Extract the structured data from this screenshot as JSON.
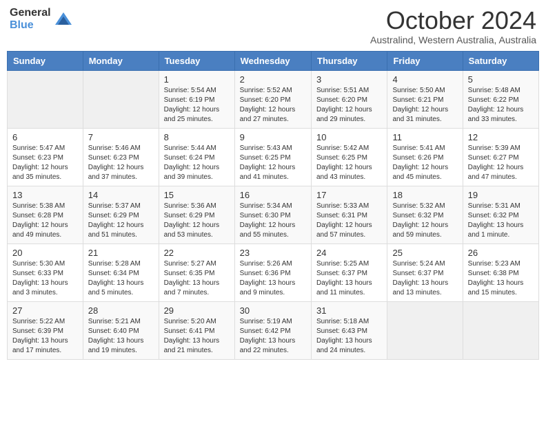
{
  "logo": {
    "general": "General",
    "blue": "Blue"
  },
  "title": "October 2024",
  "subtitle": "Australind, Western Australia, Australia",
  "headers": [
    "Sunday",
    "Monday",
    "Tuesday",
    "Wednesday",
    "Thursday",
    "Friday",
    "Saturday"
  ],
  "weeks": [
    [
      {
        "day": "",
        "info": ""
      },
      {
        "day": "",
        "info": ""
      },
      {
        "day": "1",
        "info": "Sunrise: 5:54 AM\nSunset: 6:19 PM\nDaylight: 12 hours and 25 minutes."
      },
      {
        "day": "2",
        "info": "Sunrise: 5:52 AM\nSunset: 6:20 PM\nDaylight: 12 hours and 27 minutes."
      },
      {
        "day": "3",
        "info": "Sunrise: 5:51 AM\nSunset: 6:20 PM\nDaylight: 12 hours and 29 minutes."
      },
      {
        "day": "4",
        "info": "Sunrise: 5:50 AM\nSunset: 6:21 PM\nDaylight: 12 hours and 31 minutes."
      },
      {
        "day": "5",
        "info": "Sunrise: 5:48 AM\nSunset: 6:22 PM\nDaylight: 12 hours and 33 minutes."
      }
    ],
    [
      {
        "day": "6",
        "info": "Sunrise: 5:47 AM\nSunset: 6:23 PM\nDaylight: 12 hours and 35 minutes."
      },
      {
        "day": "7",
        "info": "Sunrise: 5:46 AM\nSunset: 6:23 PM\nDaylight: 12 hours and 37 minutes."
      },
      {
        "day": "8",
        "info": "Sunrise: 5:44 AM\nSunset: 6:24 PM\nDaylight: 12 hours and 39 minutes."
      },
      {
        "day": "9",
        "info": "Sunrise: 5:43 AM\nSunset: 6:25 PM\nDaylight: 12 hours and 41 minutes."
      },
      {
        "day": "10",
        "info": "Sunrise: 5:42 AM\nSunset: 6:25 PM\nDaylight: 12 hours and 43 minutes."
      },
      {
        "day": "11",
        "info": "Sunrise: 5:41 AM\nSunset: 6:26 PM\nDaylight: 12 hours and 45 minutes."
      },
      {
        "day": "12",
        "info": "Sunrise: 5:39 AM\nSunset: 6:27 PM\nDaylight: 12 hours and 47 minutes."
      }
    ],
    [
      {
        "day": "13",
        "info": "Sunrise: 5:38 AM\nSunset: 6:28 PM\nDaylight: 12 hours and 49 minutes."
      },
      {
        "day": "14",
        "info": "Sunrise: 5:37 AM\nSunset: 6:29 PM\nDaylight: 12 hours and 51 minutes."
      },
      {
        "day": "15",
        "info": "Sunrise: 5:36 AM\nSunset: 6:29 PM\nDaylight: 12 hours and 53 minutes."
      },
      {
        "day": "16",
        "info": "Sunrise: 5:34 AM\nSunset: 6:30 PM\nDaylight: 12 hours and 55 minutes."
      },
      {
        "day": "17",
        "info": "Sunrise: 5:33 AM\nSunset: 6:31 PM\nDaylight: 12 hours and 57 minutes."
      },
      {
        "day": "18",
        "info": "Sunrise: 5:32 AM\nSunset: 6:32 PM\nDaylight: 12 hours and 59 minutes."
      },
      {
        "day": "19",
        "info": "Sunrise: 5:31 AM\nSunset: 6:32 PM\nDaylight: 13 hours and 1 minute."
      }
    ],
    [
      {
        "day": "20",
        "info": "Sunrise: 5:30 AM\nSunset: 6:33 PM\nDaylight: 13 hours and 3 minutes."
      },
      {
        "day": "21",
        "info": "Sunrise: 5:28 AM\nSunset: 6:34 PM\nDaylight: 13 hours and 5 minutes."
      },
      {
        "day": "22",
        "info": "Sunrise: 5:27 AM\nSunset: 6:35 PM\nDaylight: 13 hours and 7 minutes."
      },
      {
        "day": "23",
        "info": "Sunrise: 5:26 AM\nSunset: 6:36 PM\nDaylight: 13 hours and 9 minutes."
      },
      {
        "day": "24",
        "info": "Sunrise: 5:25 AM\nSunset: 6:37 PM\nDaylight: 13 hours and 11 minutes."
      },
      {
        "day": "25",
        "info": "Sunrise: 5:24 AM\nSunset: 6:37 PM\nDaylight: 13 hours and 13 minutes."
      },
      {
        "day": "26",
        "info": "Sunrise: 5:23 AM\nSunset: 6:38 PM\nDaylight: 13 hours and 15 minutes."
      }
    ],
    [
      {
        "day": "27",
        "info": "Sunrise: 5:22 AM\nSunset: 6:39 PM\nDaylight: 13 hours and 17 minutes."
      },
      {
        "day": "28",
        "info": "Sunrise: 5:21 AM\nSunset: 6:40 PM\nDaylight: 13 hours and 19 minutes."
      },
      {
        "day": "29",
        "info": "Sunrise: 5:20 AM\nSunset: 6:41 PM\nDaylight: 13 hours and 21 minutes."
      },
      {
        "day": "30",
        "info": "Sunrise: 5:19 AM\nSunset: 6:42 PM\nDaylight: 13 hours and 22 minutes."
      },
      {
        "day": "31",
        "info": "Sunrise: 5:18 AM\nSunset: 6:43 PM\nDaylight: 13 hours and 24 minutes."
      },
      {
        "day": "",
        "info": ""
      },
      {
        "day": "",
        "info": ""
      }
    ]
  ]
}
